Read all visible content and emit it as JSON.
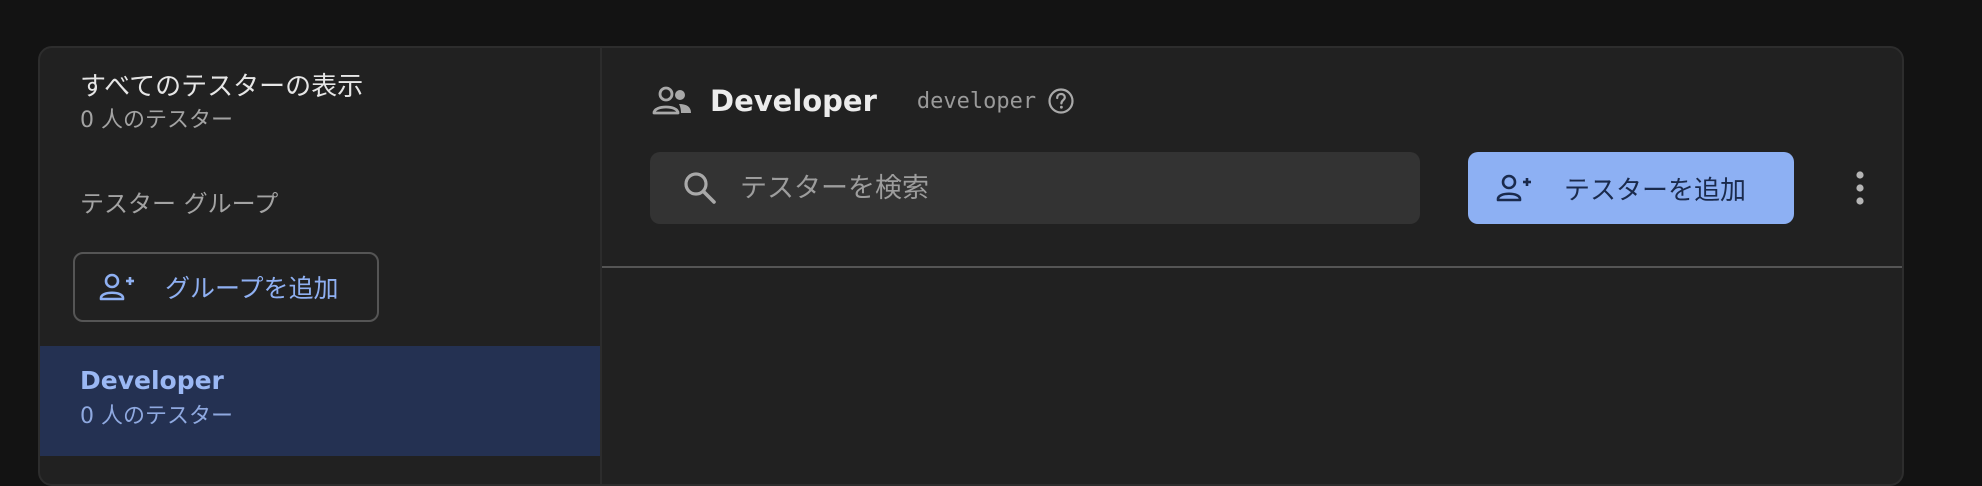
{
  "sidebar": {
    "all_testers": {
      "title": "すべてのテスターの表示",
      "count": "0 人のテスター"
    },
    "groups_header": "テスター グループ",
    "add_group_label": "グループを追加",
    "groups": [
      {
        "name": "Developer",
        "count": "0 人のテスター",
        "selected": true
      }
    ]
  },
  "main": {
    "title": "Developer",
    "slug": "developer",
    "search": {
      "placeholder": "テスターを検索",
      "value": ""
    },
    "add_tester_label": "テスターを追加"
  },
  "icons": {
    "group": "group-icon",
    "help": "help-circle-icon",
    "search": "search-icon",
    "add_person": "person-add-icon",
    "more": "more-vert-icon"
  },
  "colors": {
    "background": "#131313",
    "card": "#212121",
    "selected_row": "#243152",
    "accent": "#8db0f3",
    "accent_text": "#1a2a4c"
  }
}
